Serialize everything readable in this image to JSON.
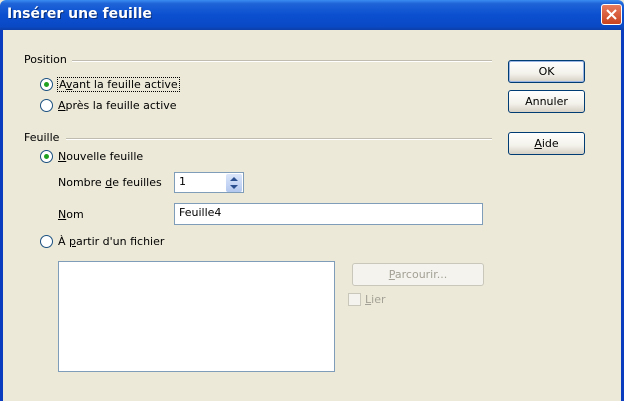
{
  "window": {
    "title": "Insérer une feuille"
  },
  "position_group": {
    "label": "Position",
    "option_before": {
      "pre": "A",
      "key": "v",
      "post": "ant la feuille active"
    },
    "option_after": {
      "pre": "",
      "key": "A",
      "post": "près la feuille active"
    }
  },
  "sheet_group": {
    "label": "Feuille",
    "option_new": {
      "pre": "",
      "key": "N",
      "post": "ouvelle feuille"
    },
    "count_label": {
      "pre": "Nombre ",
      "key": "d",
      "post": "e feuilles"
    },
    "count_value": "1",
    "name_label": {
      "pre": "",
      "key": "N",
      "post": "om"
    },
    "name_value": "Feuille4",
    "option_file": {
      "pre": "À ",
      "key": "p",
      "post": "artir d'un fichier"
    },
    "browse_button": {
      "pre": "",
      "key": "P",
      "post": "arcourir..."
    },
    "link_checkbox": {
      "pre": "",
      "key": "L",
      "post": "ier"
    }
  },
  "buttons": {
    "ok": "OK",
    "cancel": "Annuler",
    "help": {
      "pre": "",
      "key": "A",
      "post": "ide"
    }
  },
  "colors": {
    "titlebar": "#0a49c5",
    "dialog_bg": "#ece9d8",
    "radio_dot": "#21a121",
    "close": "#c9431e"
  }
}
